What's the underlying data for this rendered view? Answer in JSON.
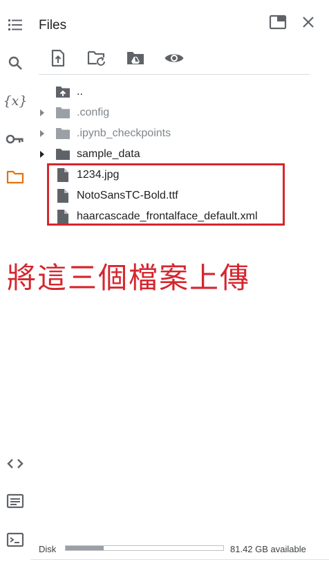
{
  "panel": {
    "title": "Files"
  },
  "rail": {
    "items": [
      {
        "icon": "table-of-contents-icon"
      },
      {
        "icon": "search-icon"
      },
      {
        "icon": "variables-icon",
        "label": "{x}"
      },
      {
        "icon": "key-icon"
      },
      {
        "icon": "folder-icon",
        "active": true
      },
      {
        "icon": "code-icon"
      },
      {
        "icon": "command-palette-icon"
      },
      {
        "icon": "terminal-icon"
      }
    ]
  },
  "header_actions": [
    {
      "icon": "open-in-tab-icon"
    },
    {
      "icon": "close-icon"
    }
  ],
  "toolbar": [
    {
      "icon": "upload-icon"
    },
    {
      "icon": "refresh-folder-icon"
    },
    {
      "icon": "mount-drive-icon"
    },
    {
      "icon": "eye-icon"
    }
  ],
  "files": [
    {
      "name": "..",
      "type": "parent",
      "expandable": false,
      "dim": false
    },
    {
      "name": ".config",
      "type": "folder",
      "expandable": true,
      "dim": true
    },
    {
      "name": ".ipynb_checkpoints",
      "type": "folder",
      "expandable": true,
      "dim": true
    },
    {
      "name": "sample_data",
      "type": "folder",
      "expandable": true,
      "dim": false
    },
    {
      "name": "1234.jpg",
      "type": "file",
      "expandable": false,
      "dim": false
    },
    {
      "name": "NotoSansTC-Bold.ttf",
      "type": "file",
      "expandable": false,
      "dim": false
    },
    {
      "name": "haarcascade_frontalface_default.xml",
      "type": "file",
      "expandable": false,
      "dim": false
    }
  ],
  "annotation": {
    "text": "將這三個檔案上傳",
    "color": "#d5262e"
  },
  "disk": {
    "label": "Disk",
    "available": "81.42 GB available",
    "used_fraction": 0.24
  },
  "colors": {
    "accent": "#e8710a",
    "icon": "#5f6368",
    "folder": "#5f6368",
    "dim_folder": "#9aa0a6",
    "highlight": "#d5262e"
  }
}
